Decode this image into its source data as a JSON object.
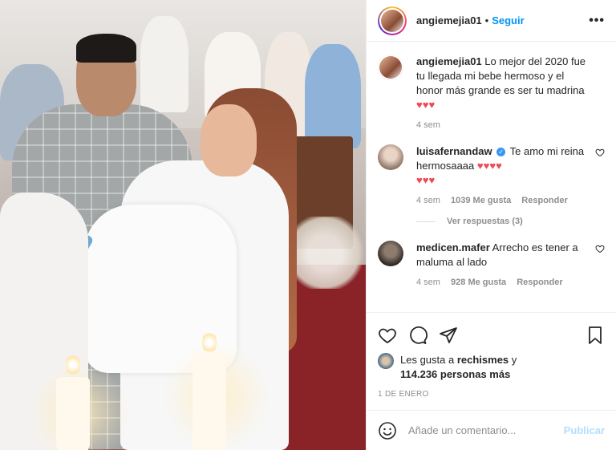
{
  "header": {
    "username": "angiemejia01",
    "separator": "•",
    "follow_label": "Seguir",
    "more_label": "•••"
  },
  "caption": {
    "username": "angiemejia01",
    "text": "Lo mejor del 2020 fue tu llegada mi bebe hermoso y el honor más grande es ser tu madrina",
    "hearts": "♥♥♥",
    "time": "4 sem"
  },
  "comments": [
    {
      "username": "luisafernandaw",
      "verified": "✓",
      "text": "Te amo mi reina hermosaaaa",
      "hearts": "♥♥♥♥",
      "hearts2": "♥♥♥",
      "time": "4 sem",
      "likes": "1039 Me gusta",
      "reply": "Responder",
      "view_replies": "Ver respuestas (3)"
    },
    {
      "username": "medicen.mafer",
      "text": "Arrecho es tener a maluma al lado",
      "time": "4 sem",
      "likes": "928 Me gusta",
      "reply": "Responder"
    }
  ],
  "likes": {
    "prefix": "Les gusta a",
    "user": "rechismes",
    "conj": "y",
    "count": "114.236 personas más"
  },
  "date": "1 DE ENERO",
  "add_comment": {
    "placeholder": "Añade un comentario...",
    "publish_label": "Publicar"
  },
  "colors": {
    "accent": "#0095f6",
    "heart": "#ed4956",
    "muted": "#8e8e8e",
    "publish_disabled": "#b2dffc"
  }
}
